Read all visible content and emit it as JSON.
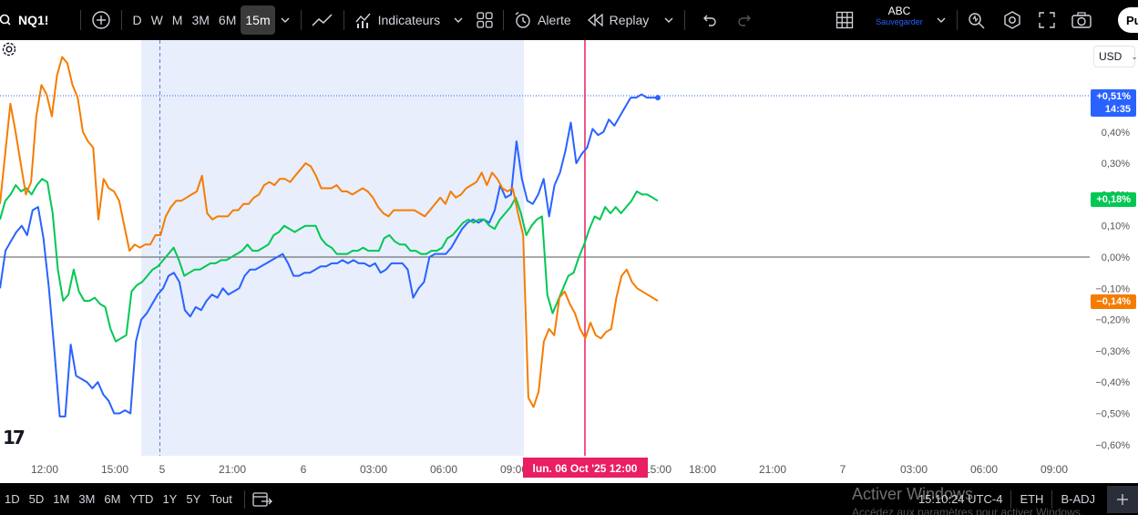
{
  "toolbar": {
    "symbol": "NQ1!",
    "intervals": [
      "D",
      "W",
      "M",
      "3M",
      "6M",
      "15m"
    ],
    "active_interval": "15m",
    "indicators_label": "Indicateurs",
    "alert_label": "Alerte",
    "replay_label": "Replay",
    "layout_name": "ABC",
    "save_label": "Sauvegarder",
    "publish_label": "Pu"
  },
  "price_scale": {
    "currency": "USD",
    "ticks": [
      "0,40%",
      "0,30%",
      "0,20%",
      "0,10%",
      "0,00%",
      "−0,10%",
      "−0,20%",
      "−0,30%",
      "−0,40%",
      "−0,50%",
      "−0,60%"
    ],
    "labels": {
      "blue_value": "+0,51%",
      "blue_time": "14:35",
      "green_value": "+0,18%",
      "orange_value": "−0,14%"
    }
  },
  "time_axis": {
    "ticks": [
      "12:00",
      "15:00",
      "5",
      "21:00",
      "6",
      "03:00",
      "06:00",
      "09:00",
      "15:00",
      "18:00",
      "21:00",
      "7",
      "03:00",
      "06:00",
      "09:00"
    ],
    "crosshair_label": "lun. 06 Oct '25   12:00"
  },
  "bottom": {
    "ranges": [
      "1D",
      "5D",
      "1M",
      "3M",
      "6M",
      "YTD",
      "1Y",
      "5Y",
      "Tout"
    ],
    "time": "15:10:24 UTC-4",
    "session": "ETH",
    "adjust": "B-ADJ",
    "watermark": "Activer Windows",
    "watermark_sub": "Accédez aux paramètres pour activer Windows."
  },
  "colors": {
    "blue": "#2962ff",
    "green": "#00c853",
    "orange": "#f57c00",
    "crosshair": "#e91e63",
    "session_bg": "#e8eefc"
  },
  "chart_data": {
    "type": "line",
    "ylim": [
      -0.62,
      0.62
    ],
    "y_unit": "%",
    "x_index_range": [
      0,
      140
    ],
    "series": [
      {
        "color": "#2962ff",
        "values": [
          -0.1,
          0.02,
          0.05,
          0.08,
          0.1,
          0.07,
          0.15,
          0.16,
          0.06,
          -0.1,
          -0.3,
          -0.51,
          -0.51,
          -0.28,
          -0.38,
          -0.39,
          -0.4,
          -0.42,
          -0.4,
          -0.44,
          -0.46,
          -0.5,
          -0.5,
          -0.49,
          -0.5,
          -0.27,
          -0.2,
          -0.18,
          -0.15,
          -0.12,
          -0.1,
          -0.06,
          -0.05,
          -0.08,
          -0.17,
          -0.19,
          -0.16,
          -0.17,
          -0.14,
          -0.12,
          -0.13,
          -0.1,
          -0.12,
          -0.11,
          -0.1,
          -0.06,
          -0.04,
          -0.04,
          -0.03,
          -0.02,
          -0.01,
          0.0,
          0.01,
          -0.02,
          -0.06,
          -0.06,
          -0.05,
          -0.05,
          -0.04,
          -0.03,
          -0.03,
          -0.02,
          -0.02,
          -0.01,
          -0.02,
          -0.01,
          -0.02,
          -0.02,
          -0.03,
          -0.02,
          -0.05,
          -0.04,
          -0.02,
          -0.02,
          -0.02,
          -0.04,
          -0.13,
          -0.1,
          -0.08,
          0.0,
          0.01,
          0.01,
          0.01,
          0.03,
          0.06,
          0.09,
          0.11,
          0.12,
          0.11,
          0.12,
          0.11,
          0.15,
          0.23,
          0.19,
          0.2,
          0.37,
          0.25,
          0.18,
          0.17,
          0.2,
          0.25,
          0.13,
          0.23,
          0.27,
          0.34,
          0.43,
          0.3,
          0.33,
          0.35,
          0.41,
          0.39,
          0.4,
          0.44,
          0.42,
          0.45,
          0.48,
          0.51,
          0.51,
          0.52,
          0.51,
          0.51,
          0.51
        ],
        "x_start_index": 0
      },
      {
        "color": "#00c853",
        "values": [
          0.12,
          0.18,
          0.2,
          0.23,
          0.21,
          0.22,
          0.2,
          0.23,
          0.25,
          0.24,
          0.14,
          -0.04,
          -0.14,
          -0.12,
          -0.04,
          -0.11,
          -0.14,
          -0.14,
          -0.13,
          -0.15,
          -0.16,
          -0.23,
          -0.27,
          -0.26,
          -0.25,
          -0.11,
          -0.09,
          -0.08,
          -0.06,
          -0.04,
          -0.03,
          -0.01,
          0.01,
          0.03,
          -0.01,
          -0.06,
          -0.05,
          -0.04,
          -0.04,
          -0.03,
          -0.02,
          -0.02,
          -0.01,
          -0.01,
          0.0,
          0.01,
          0.02,
          0.04,
          0.02,
          0.02,
          0.03,
          0.04,
          0.07,
          0.08,
          0.1,
          0.09,
          0.08,
          0.09,
          0.1,
          0.1,
          0.1,
          0.06,
          0.04,
          0.03,
          0.01,
          0.01,
          0.01,
          0.02,
          0.02,
          0.03,
          0.02,
          0.02,
          0.02,
          0.06,
          0.07,
          0.05,
          0.04,
          0.04,
          0.02,
          0.02,
          0.01,
          0.01,
          0.02,
          0.02,
          0.03,
          0.06,
          0.07,
          0.09,
          0.11,
          0.12,
          0.11,
          0.12,
          0.12,
          0.1,
          0.09,
          0.12,
          0.14,
          0.16,
          0.19,
          0.14,
          0.07,
          0.1,
          0.12,
          0.13,
          -0.12,
          -0.18,
          -0.14,
          -0.1,
          -0.06,
          -0.05,
          0.0,
          0.04,
          0.09,
          0.13,
          0.12,
          0.16,
          0.14,
          0.16,
          0.14,
          0.16,
          0.18,
          0.21,
          0.2,
          0.2,
          0.19,
          0.18
        ],
        "x_start_index": 0
      },
      {
        "color": "#f57c00",
        "values": [
          0.17,
          0.33,
          0.49,
          0.4,
          0.3,
          0.2,
          0.24,
          0.45,
          0.55,
          0.52,
          0.45,
          0.58,
          0.64,
          0.62,
          0.55,
          0.51,
          0.4,
          0.37,
          0.35,
          0.12,
          0.25,
          0.22,
          0.21,
          0.18,
          0.1,
          0.02,
          0.04,
          0.03,
          0.04,
          0.04,
          0.07,
          0.07,
          0.13,
          0.16,
          0.18,
          0.18,
          0.19,
          0.2,
          0.21,
          0.26,
          0.14,
          0.12,
          0.13,
          0.13,
          0.13,
          0.15,
          0.15,
          0.17,
          0.17,
          0.19,
          0.2,
          0.23,
          0.24,
          0.23,
          0.25,
          0.25,
          0.24,
          0.26,
          0.28,
          0.3,
          0.29,
          0.26,
          0.22,
          0.22,
          0.22,
          0.23,
          0.21,
          0.21,
          0.2,
          0.21,
          0.22,
          0.21,
          0.19,
          0.16,
          0.14,
          0.13,
          0.15,
          0.15,
          0.15,
          0.15,
          0.15,
          0.14,
          0.13,
          0.15,
          0.17,
          0.19,
          0.17,
          0.21,
          0.19,
          0.2,
          0.22,
          0.23,
          0.24,
          0.27,
          0.23,
          0.27,
          0.25,
          0.22,
          0.21,
          0.22,
          0.14,
          0.07,
          -0.45,
          -0.48,
          -0.43,
          -0.27,
          -0.23,
          -0.25,
          -0.13,
          -0.11,
          -0.15,
          -0.18,
          -0.23,
          -0.26,
          -0.21,
          -0.25,
          -0.26,
          -0.24,
          -0.23,
          -0.13,
          -0.06,
          -0.04,
          -0.08,
          -0.1,
          -0.11,
          -0.12,
          -0.13,
          -0.14
        ],
        "x_start_index": 0
      }
    ]
  }
}
